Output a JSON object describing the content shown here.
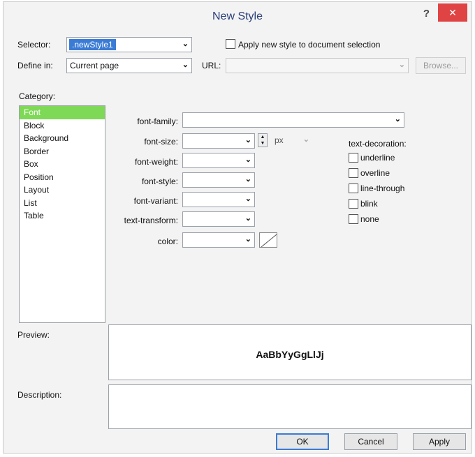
{
  "window": {
    "title": "New Style",
    "help_label": "?",
    "close_label": "✕"
  },
  "selector": {
    "label": "Selector:",
    "value": ".newStyle1"
  },
  "apply_to_selection": {
    "label": "Apply new style to document selection",
    "checked": false
  },
  "define_in": {
    "label": "Define in:",
    "value": "Current page"
  },
  "url": {
    "label": "URL:",
    "value": ""
  },
  "browse_label": "Browse...",
  "category": {
    "label": "Category:",
    "items": [
      "Font",
      "Block",
      "Background",
      "Border",
      "Box",
      "Position",
      "Layout",
      "List",
      "Table"
    ],
    "selected": "Font"
  },
  "font": {
    "family_label": "font-family:",
    "size_label": "font-size:",
    "size_unit": "px",
    "weight_label": "font-weight:",
    "style_label": "font-style:",
    "variant_label": "font-variant:",
    "transform_label": "text-transform:",
    "color_label": "color:"
  },
  "text_decoration": {
    "label": "text-decoration:",
    "options": [
      "underline",
      "overline",
      "line-through",
      "blink",
      "none"
    ]
  },
  "preview": {
    "label": "Preview:",
    "sample": "AaBbYyGgLlJj"
  },
  "description": {
    "label": "Description:"
  },
  "buttons": {
    "ok": "OK",
    "cancel": "Cancel",
    "apply": "Apply"
  }
}
